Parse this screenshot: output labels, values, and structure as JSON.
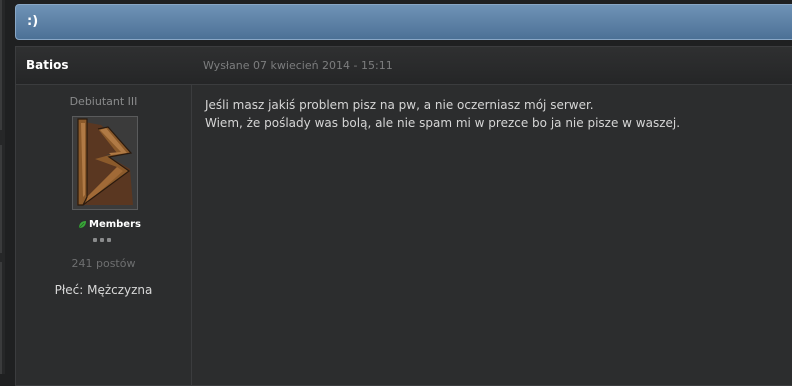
{
  "topic": {
    "title": ":)"
  },
  "post": {
    "author": "Batios",
    "date": "Wysłane 07 kwiecień 2014 - 15:11",
    "rank": "Debiutant III",
    "group": "Members",
    "post_count": "241 postów",
    "gender": "Płeć: Mężczyzna",
    "body_lines": [
      "Jeśli masz jakiś problem pisz na pw, a nie oczerniasz mój serwer.",
      "Wiem, że poślady was bolą, ale nie spam mi w prezce bo ja nie pisze w waszej."
    ]
  },
  "colors": {
    "topic_bar": "#5a7fa6",
    "group_icon": "#3aa53a"
  }
}
